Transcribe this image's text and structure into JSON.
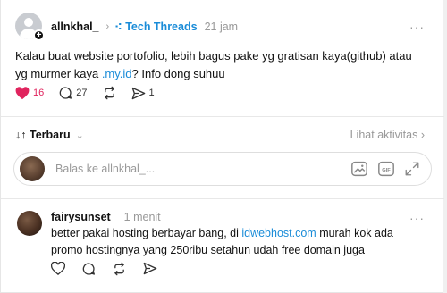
{
  "post": {
    "username": "allnkhal_",
    "topic": "Tech Threads",
    "time": "21 jam",
    "text_before_link": "Kalau buat website portofolio, lebih bagus pake yg gratisan kaya(github) atau yg murmer kaya ",
    "link": ".my.id",
    "text_after_link": "? Info dong suhuu",
    "likes": "16",
    "comments": "27",
    "shares": "1",
    "more_label": "···"
  },
  "sort": {
    "label": "Terbaru",
    "activity_label": "Lihat aktivitas"
  },
  "reply": {
    "placeholder": "Balas ke allnkhal_..."
  },
  "comment": {
    "username": "fairysunset_",
    "time": "1 menit",
    "text_before_link": "better pakai hosting berbayar bang, di ",
    "link": "idwebhost.com",
    "text_after_link": " murah kok ada promo hostingnya yang 250ribu setahun udah free domain juga",
    "more_label": "···"
  },
  "colors": {
    "accent": "#1a8cd8",
    "like": "#e0245e"
  },
  "icons": [
    "follow-plus-icon",
    "heart-icon",
    "comment-icon",
    "repost-icon",
    "share-icon",
    "gif-icon",
    "image-icon",
    "expand-icon"
  ]
}
